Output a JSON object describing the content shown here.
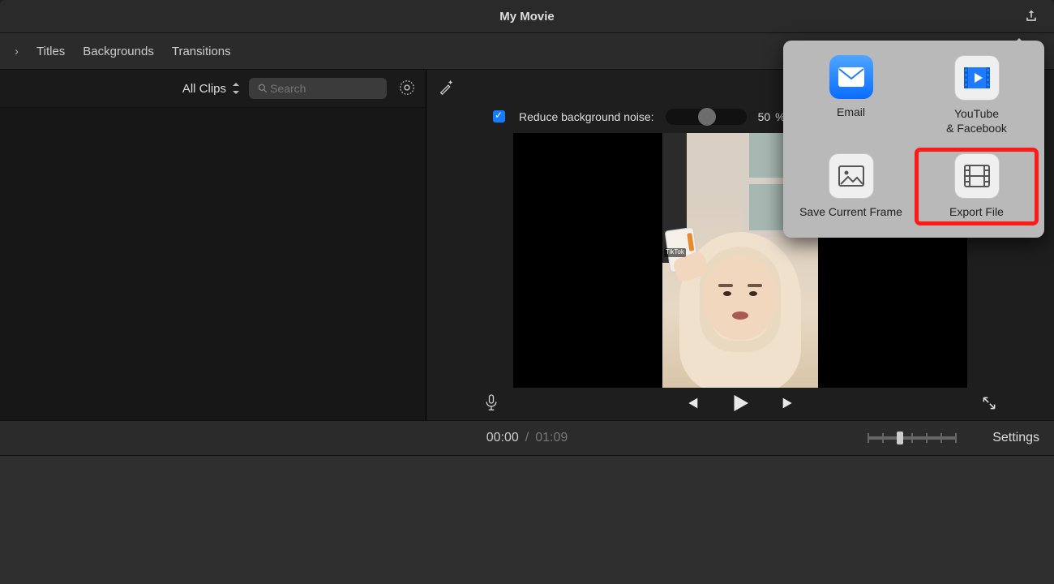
{
  "window": {
    "title": "My Movie"
  },
  "tabs": [
    {
      "label": "Titles"
    },
    {
      "label": "Backgrounds"
    },
    {
      "label": "Transitions"
    }
  ],
  "sidebar": {
    "clips_filter": "All Clips",
    "search_placeholder": "Search"
  },
  "viewer": {
    "noise": {
      "checked": true,
      "label": "Reduce background noise:",
      "value": "50",
      "unit": "%"
    },
    "icons": {
      "tool1": "effects-balance-icon",
      "tool2": "color-palette-icon",
      "tool3": "crop-icon",
      "tool4": "camera-icon",
      "tool5": "volume-icon",
      "tool6": "noise-equalizer-icon",
      "tool7": "speed-gauge-icon"
    }
  },
  "transport": {
    "current_time": "00:00",
    "separator": "/",
    "duration": "01:09",
    "settings": "Settings"
  },
  "share_popover": {
    "items": [
      {
        "label": "Email",
        "kind": "blue",
        "icon": "envelope-icon"
      },
      {
        "label": "YouTube\n& Facebook",
        "kind": "white",
        "icon": "film-play-icon"
      },
      {
        "label": "Save Current Frame",
        "kind": "white",
        "icon": "image-icon"
      },
      {
        "label": "Export File",
        "kind": "white",
        "icon": "film-export-icon",
        "highlight": true
      }
    ]
  },
  "preview_clip": {
    "watermark": "TikTok"
  }
}
